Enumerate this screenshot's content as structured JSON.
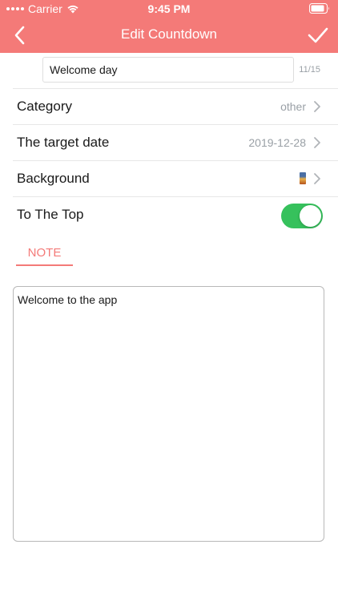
{
  "status_bar": {
    "carrier": "Carrier",
    "time": "9:45 PM"
  },
  "nav": {
    "title": "Edit Countdown",
    "back_icon": "chevron-left-icon",
    "done_icon": "checkmark-icon"
  },
  "name_field": {
    "value": "Welcome day",
    "counter": "11/15"
  },
  "rows": {
    "category": {
      "label": "Category",
      "value": "other"
    },
    "target_date": {
      "label": "The target date",
      "value": "2019-12-28"
    },
    "background": {
      "label": "Background",
      "thumb_icon": "background-thumbnail-icon"
    },
    "to_the_top": {
      "label": "To The Top",
      "toggle_on": true
    }
  },
  "note": {
    "tab_label": "NOTE",
    "text": "Welcome to the app"
  },
  "colors": {
    "accent": "#f47a78",
    "toggle_on": "#36c15c",
    "secondary_text": "#9aa0a6"
  }
}
